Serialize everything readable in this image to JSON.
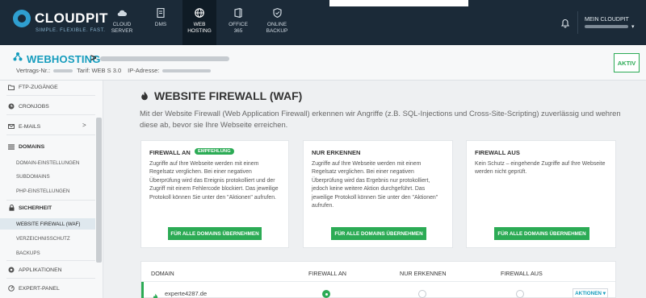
{
  "brand": {
    "name_part1": "CLOUD",
    "name_part2": "PIT",
    "tagline": "SIMPLE. FLEXIBLE. FAST.",
    "accent": "#2f9fd0"
  },
  "nav": {
    "items": [
      {
        "line1": "CLOUD",
        "line2": "SERVER",
        "icon": "cloud-icon"
      },
      {
        "line1": "DMS",
        "line2": "",
        "icon": "document-icon"
      },
      {
        "line1": "WEB",
        "line2": "HOSTING",
        "icon": "globe-icon",
        "active": true
      },
      {
        "line1": "OFFICE",
        "line2": "365",
        "icon": "office-icon"
      },
      {
        "line1": "ONLINE",
        "line2": "BACKUP",
        "icon": "shield-icon"
      }
    ],
    "user_label": "MEIN CLOUDPIT"
  },
  "header": {
    "title": "WEBHOSTING",
    "arrow": ">",
    "contract_label": "Vertrags-Nr.:",
    "tariff": "Tarif: WEB S 3.0",
    "ip_label": "IP-Adresse:",
    "status_button": "AKTIV",
    "status_color": "#2cab55"
  },
  "sidebar": {
    "items": [
      {
        "label": "FTP-ZUGÄNGE",
        "icon": "folder-icon"
      },
      {
        "label": "CRONJOBS",
        "icon": "clock-icon"
      },
      {
        "label": "E-MAILS",
        "icon": "envelope-icon",
        "chevron": ">"
      },
      {
        "label": "DOMAINS",
        "icon": "list-icon"
      },
      {
        "label": "SICHERHEIT",
        "icon": "lock-icon"
      },
      {
        "label": "APPLIKATIONEN",
        "icon": "app-icon"
      },
      {
        "label": "EXPERT-PANEL",
        "icon": "panel-icon"
      }
    ],
    "domains_sub": [
      "DOMAIN-EINSTELLUNGEN",
      "SUBDOMAINS",
      "PHP-EINSTELLUNGEN"
    ],
    "security_sub": [
      "WEBSITE FIREWALL (WAF)",
      "VERZEICHNISSCHUTZ",
      "BACKUPS"
    ]
  },
  "main": {
    "title": "WEBSITE FIREWALL (WAF)",
    "intro": "Mit der Website Firewall (Web Application Firewall) erkennen wir Angriffe (z.B. SQL-Injections und Cross-Site-Scripting) zuverlässig und wehren diese ab, bevor sie Ihre Webseite erreichen.",
    "cards": [
      {
        "title": "FIREWALL AN",
        "badge": "EMPFEHLUNG",
        "text": "Zugriffe auf Ihre Webseite werden mit einem Regelsatz verglichen. Bei einer negativen Überprüfung wird das Ereignis protokolliert und der Zugriff mit einem Fehlercode blockiert. Das jeweilige Protokoll können Sie unter den \"Aktionen\" aufrufen.",
        "button": "FÜR ALLE DOMAINS ÜBERNEHMEN"
      },
      {
        "title": "NUR ERKENNEN",
        "text": "Zugriffe auf Ihre Webseite werden mit einem Regelsatz verglichen. Bei einer negativen Überprüfung wird das Ergebnis nur protokolliert, jedoch keine weitere Aktion durchgeführt. Das jeweilige Protokoll können Sie unter den \"Aktionen\" aufrufen.",
        "button": "FÜR ALLE DOMAINS ÜBERNEHMEN"
      },
      {
        "title": "FIREWALL AUS",
        "text": "Kein Schutz – eingehende Zugriffe auf Ihre Webseite werden nicht geprüft.",
        "button": "FÜR ALLE DOMAINS ÜBERNEHMEN"
      }
    ],
    "table": {
      "headers": [
        "DOMAIN",
        "FIREWALL AN",
        "NUR ERKENNEN",
        "FIREWALL AUS"
      ],
      "rows": [
        {
          "domain": "experte4287.de",
          "mode": "FIREWALL AN",
          "action": "AKTIONEN ▾"
        }
      ]
    }
  }
}
